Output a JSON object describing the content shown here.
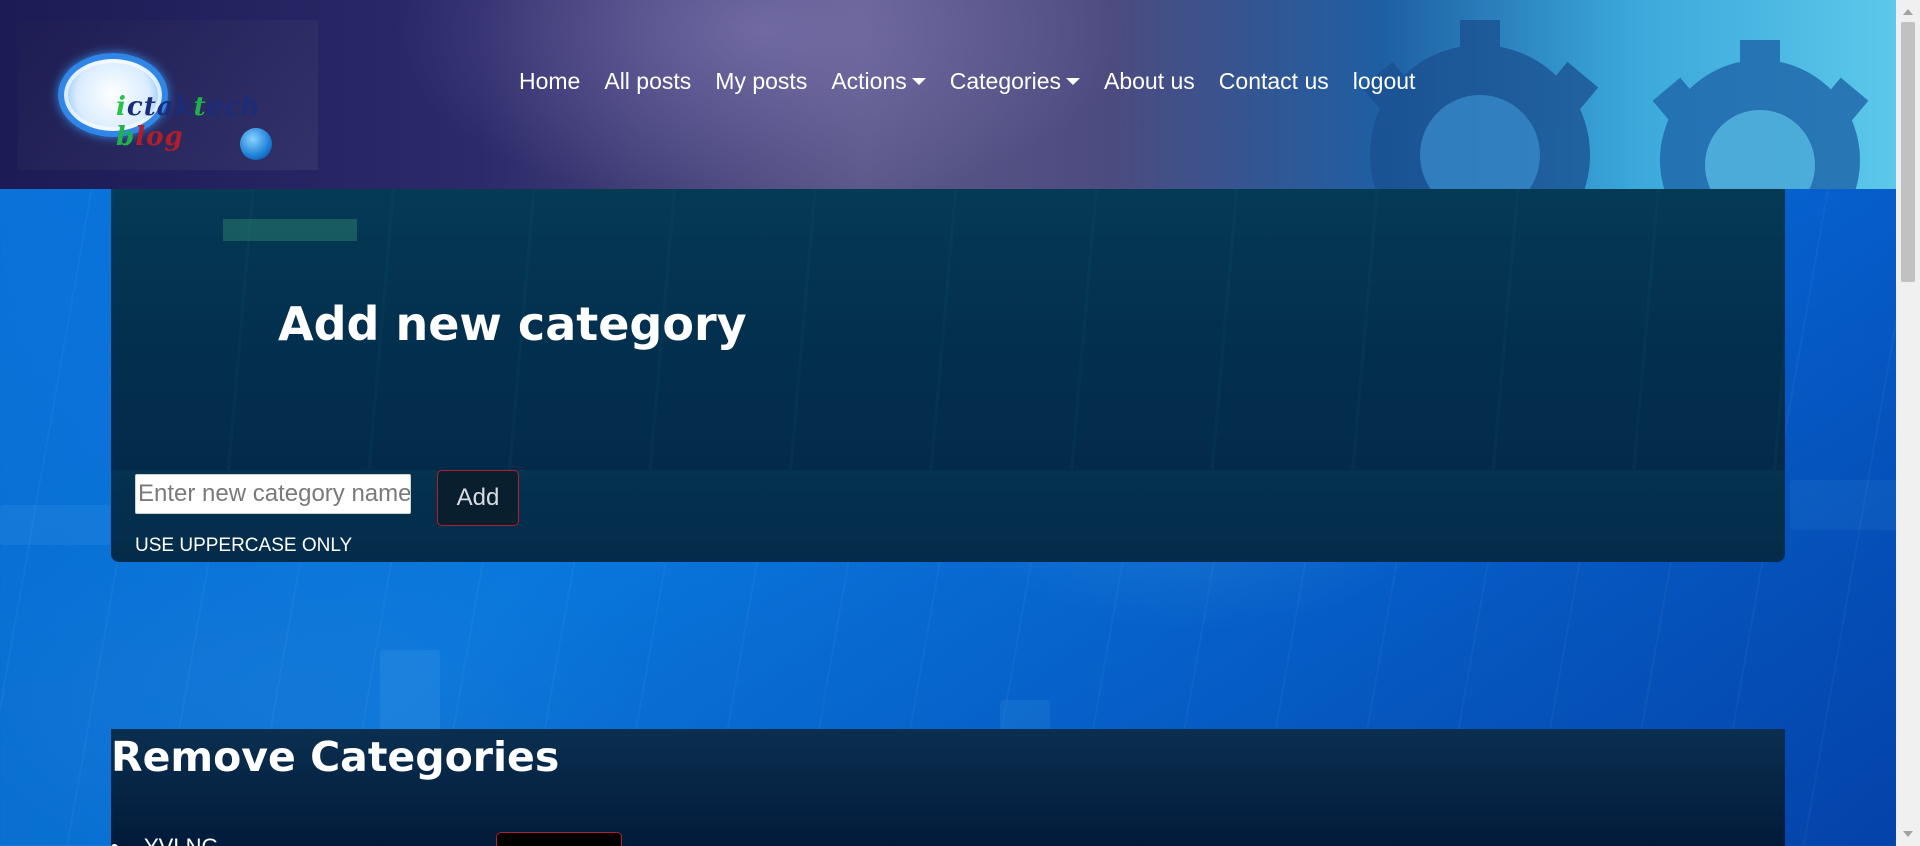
{
  "header": {
    "logo_alt": "ictaktech blog",
    "nav": [
      {
        "label": "Home",
        "dropdown": false
      },
      {
        "label": "All posts",
        "dropdown": false
      },
      {
        "label": "My posts",
        "dropdown": false
      },
      {
        "label": "Actions",
        "dropdown": true
      },
      {
        "label": "Categories",
        "dropdown": true
      },
      {
        "label": "About us",
        "dropdown": false
      },
      {
        "label": "Contact us",
        "dropdown": false
      },
      {
        "label": "logout",
        "dropdown": false
      }
    ]
  },
  "add_category": {
    "title": "Add new category",
    "input_placeholder": "Enter new category name",
    "input_value": "",
    "add_label": "Add",
    "hint": "USE UPPERCASE ONLY"
  },
  "remove_categories": {
    "title": "Remove Categories",
    "items": [
      {
        "name": "YVLNG"
      }
    ]
  },
  "colors": {
    "accent_border": "#b11f2b",
    "panel_bg": "#03304e",
    "page_bg": "#0a7ee6"
  },
  "icons": {
    "dropdown": "caret-down-icon"
  }
}
